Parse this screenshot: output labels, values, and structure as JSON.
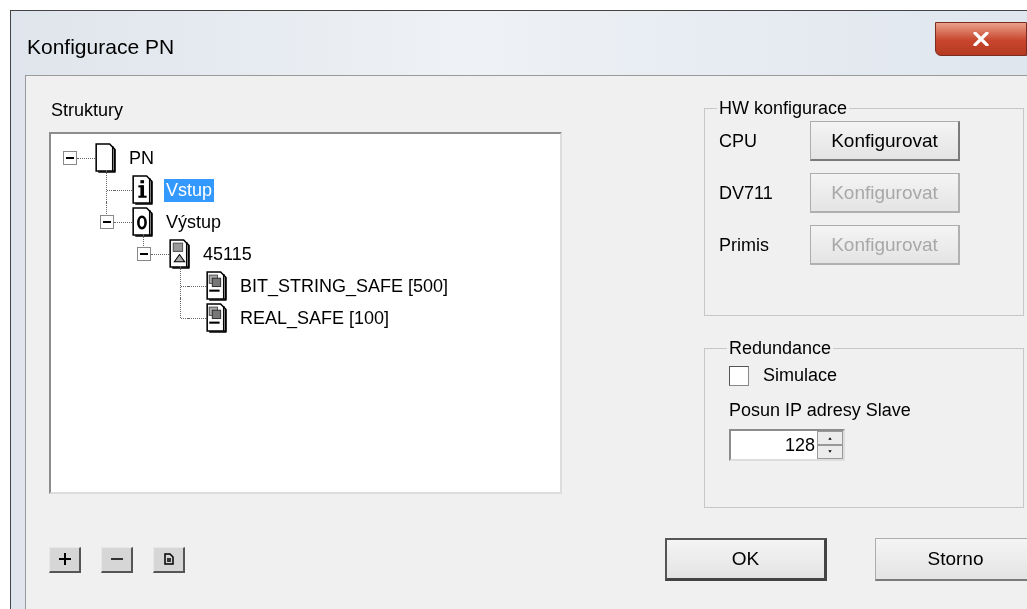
{
  "window": {
    "title": "Konfigurace PN"
  },
  "structure": {
    "label": "Struktury",
    "tree": [
      {
        "label": "PN",
        "kind": "page",
        "expanded": true,
        "selected": false,
        "children": [
          {
            "label": "Vstup",
            "kind": "input",
            "selected": true
          },
          {
            "label": "Výstup",
            "kind": "output",
            "expanded": true,
            "selected": false,
            "children": [
              {
                "label": "45115",
                "kind": "device",
                "expanded": true,
                "selected": false,
                "children": [
                  {
                    "label": "BIT_STRING_SAFE [500]",
                    "kind": "module",
                    "selected": false
                  },
                  {
                    "label": "REAL_SAFE [100]",
                    "kind": "module",
                    "selected": false
                  }
                ]
              }
            ]
          }
        ]
      }
    ]
  },
  "tree_buttons": [
    {
      "kind": "add"
    },
    {
      "kind": "remove"
    },
    {
      "kind": "document"
    }
  ],
  "hw_config": {
    "title": "HW konfigurace",
    "rows": [
      {
        "label": "CPU",
        "button": "Konfigurovat",
        "disabled": false
      },
      {
        "label": "DV711",
        "button": "Konfigurovat",
        "disabled": true
      },
      {
        "label": "Primis",
        "button": "Konfigurovat",
        "disabled": true
      }
    ]
  },
  "redundancy": {
    "title": "Redundance",
    "simulation": {
      "label": "Simulace",
      "checked": false
    },
    "ip_offset": {
      "label": "Posun IP adresy Slave",
      "value": "128"
    }
  },
  "buttons": [
    {
      "label": "OK",
      "default": true
    },
    {
      "label": "Storno",
      "default": false
    }
  ]
}
